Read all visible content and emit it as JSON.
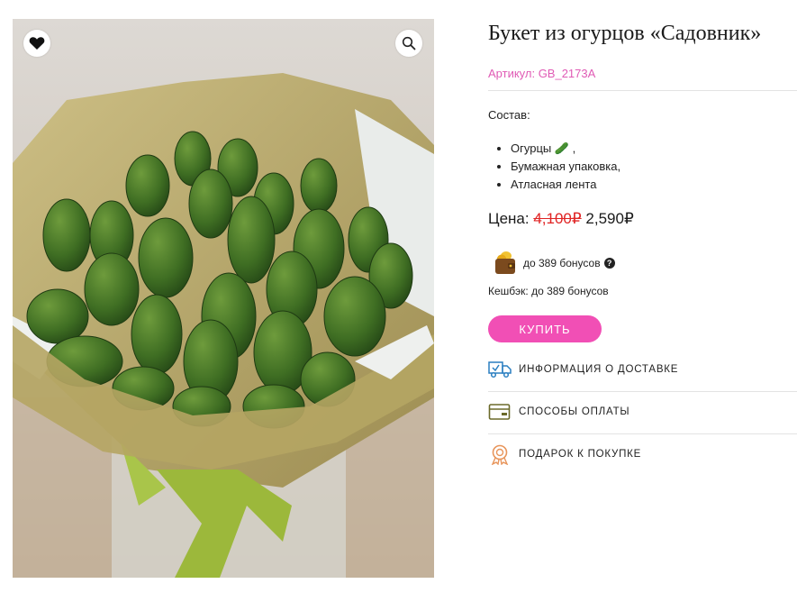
{
  "product": {
    "title": "Букет из огурцов «Садовник»",
    "sku": "Артикул: GB_2173A"
  },
  "composition": {
    "label": "Состав:",
    "items": [
      "Огурцы 🥒 ,",
      "Бумажная упаковка,",
      "Атласная лента"
    ]
  },
  "price": {
    "label": "Цена: ",
    "old": "4,100₽",
    "current": "2,590₽"
  },
  "bonus": {
    "text": "до 389 бонусов",
    "cashback": "Кешбэк: до 389 бонусов"
  },
  "buy_label": "КУПИТЬ",
  "info_links": {
    "delivery": "ИНФОРМАЦИЯ О ДОСТАВКЕ",
    "payment": "СПОСОБЫ ОПЛАТЫ",
    "gift": "ПОДАРОК К ПОКУПКЕ"
  },
  "icons": {
    "favorite": "heart-icon",
    "zoom": "magnifier-icon",
    "wallet": "wallet-icon",
    "help": "question-icon",
    "delivery": "truck-icon",
    "payment": "card-icon",
    "gift": "gift-badge-icon"
  },
  "colors": {
    "accent": "#f14fb5",
    "sku": "#e05bb5",
    "old_price": "#e02424",
    "icon_blue": "#2a7fc1",
    "icon_olive": "#6b6a2a",
    "icon_orange": "#e8955b"
  }
}
